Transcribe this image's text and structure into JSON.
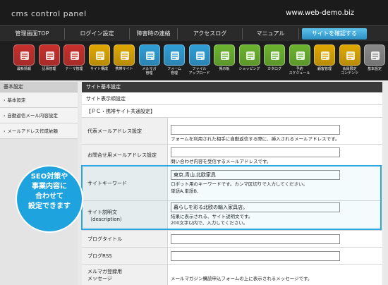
{
  "header": {
    "brand": "cms control panel",
    "url": "www.web-demo.biz"
  },
  "nav": {
    "items": [
      "管理画面TOP",
      "ログイン設定",
      "障害時の連絡",
      "アクセスログ",
      "マニュアル",
      "サイトを確認する"
    ]
  },
  "toolbar": {
    "items": [
      {
        "label": "最新情報",
        "icon": "news-icon",
        "color": "#c9302c"
      },
      {
        "label": "記事管理",
        "icon": "article-icon",
        "color": "#c9302c"
      },
      {
        "label": "テーマ管理",
        "icon": "theme-icon",
        "color": "#c9302c"
      },
      {
        "label": "サイト構成",
        "icon": "site-structure-icon",
        "color": "#e0a800"
      },
      {
        "label": "携帯サイト",
        "icon": "mobile-icon",
        "color": "#e0a800"
      },
      {
        "label": "メルマガ\n管理",
        "icon": "mail-icon",
        "color": "#2f9fd7"
      },
      {
        "label": "フォーム\n管理",
        "icon": "form-icon",
        "color": "#2f9fd7"
      },
      {
        "label": "ファイル\nアップロード",
        "icon": "file-upload-icon",
        "color": "#2f9fd7"
      },
      {
        "label": "掲示板",
        "icon": "bbs-icon",
        "color": "#6cb52f"
      },
      {
        "label": "ショッピング",
        "icon": "shopping-icon",
        "color": "#6cb52f"
      },
      {
        "label": "カタログ",
        "icon": "catalog-icon",
        "color": "#6cb52f"
      },
      {
        "label": "予約\nスケジュール",
        "icon": "schedule-icon",
        "color": "#6cb52f"
      },
      {
        "label": "顧客管理",
        "icon": "customer-icon",
        "color": "#e0a800"
      },
      {
        "label": "会員限定\nコンテンツ",
        "icon": "members-icon",
        "color": "#e0a800"
      },
      {
        "label": "基本設定",
        "icon": "settings-icon",
        "color": "#8a8a8a"
      }
    ]
  },
  "sidebar": {
    "title": "基本設定",
    "items": [
      "基本設定",
      "自動返信メール内容設定",
      "メールアドレス作成依頼"
    ]
  },
  "main": {
    "title": "サイト基本設定",
    "section1": "サイト表示順設定",
    "section2": "【ＰＣ・携帯サイト共通設定】",
    "fields": {
      "rep_email": {
        "label": "代表メールアドレス設定",
        "value": "",
        "help": "フォームを利用された相手に自動返信する際に、挿入されるメールアドレスです。"
      },
      "inquiry_email": {
        "label": "お問合せ用メールアドレス設定",
        "value": "",
        "help": "問い合わせ内容を受信するメールアドレスです。"
      },
      "keywords": {
        "label": "サイトキーワード",
        "value": "東京,青山,北欧家具",
        "help1": "ロボット用のキーワードです。カンマ区切りで入力してください。",
        "help2": "単語A,単語B,"
      },
      "description": {
        "label1": "サイト説明文",
        "label2": "（description）",
        "value": "暮らしを彩る北欧の輸入家具店。",
        "help1": "結果に表示される、サイト説明文です。",
        "help2": "200文字以内で、入力してください。"
      },
      "blog_title": {
        "label": "ブログタイトル",
        "value": ""
      },
      "blog_rss": {
        "label": "ブログRSS",
        "value": ""
      },
      "mailmag": {
        "label1": "メルマガ登録用",
        "label2": "メッセージ",
        "help": "メールマガジン購読申込フォームの上に表示されるメッセージです。"
      }
    }
  },
  "callout": {
    "text": "SEO対策や\n事業内容に\n合わせて\n設定できます"
  },
  "colors": {
    "accent": "#29a7e0",
    "header_bg": "#1b1b1b"
  }
}
